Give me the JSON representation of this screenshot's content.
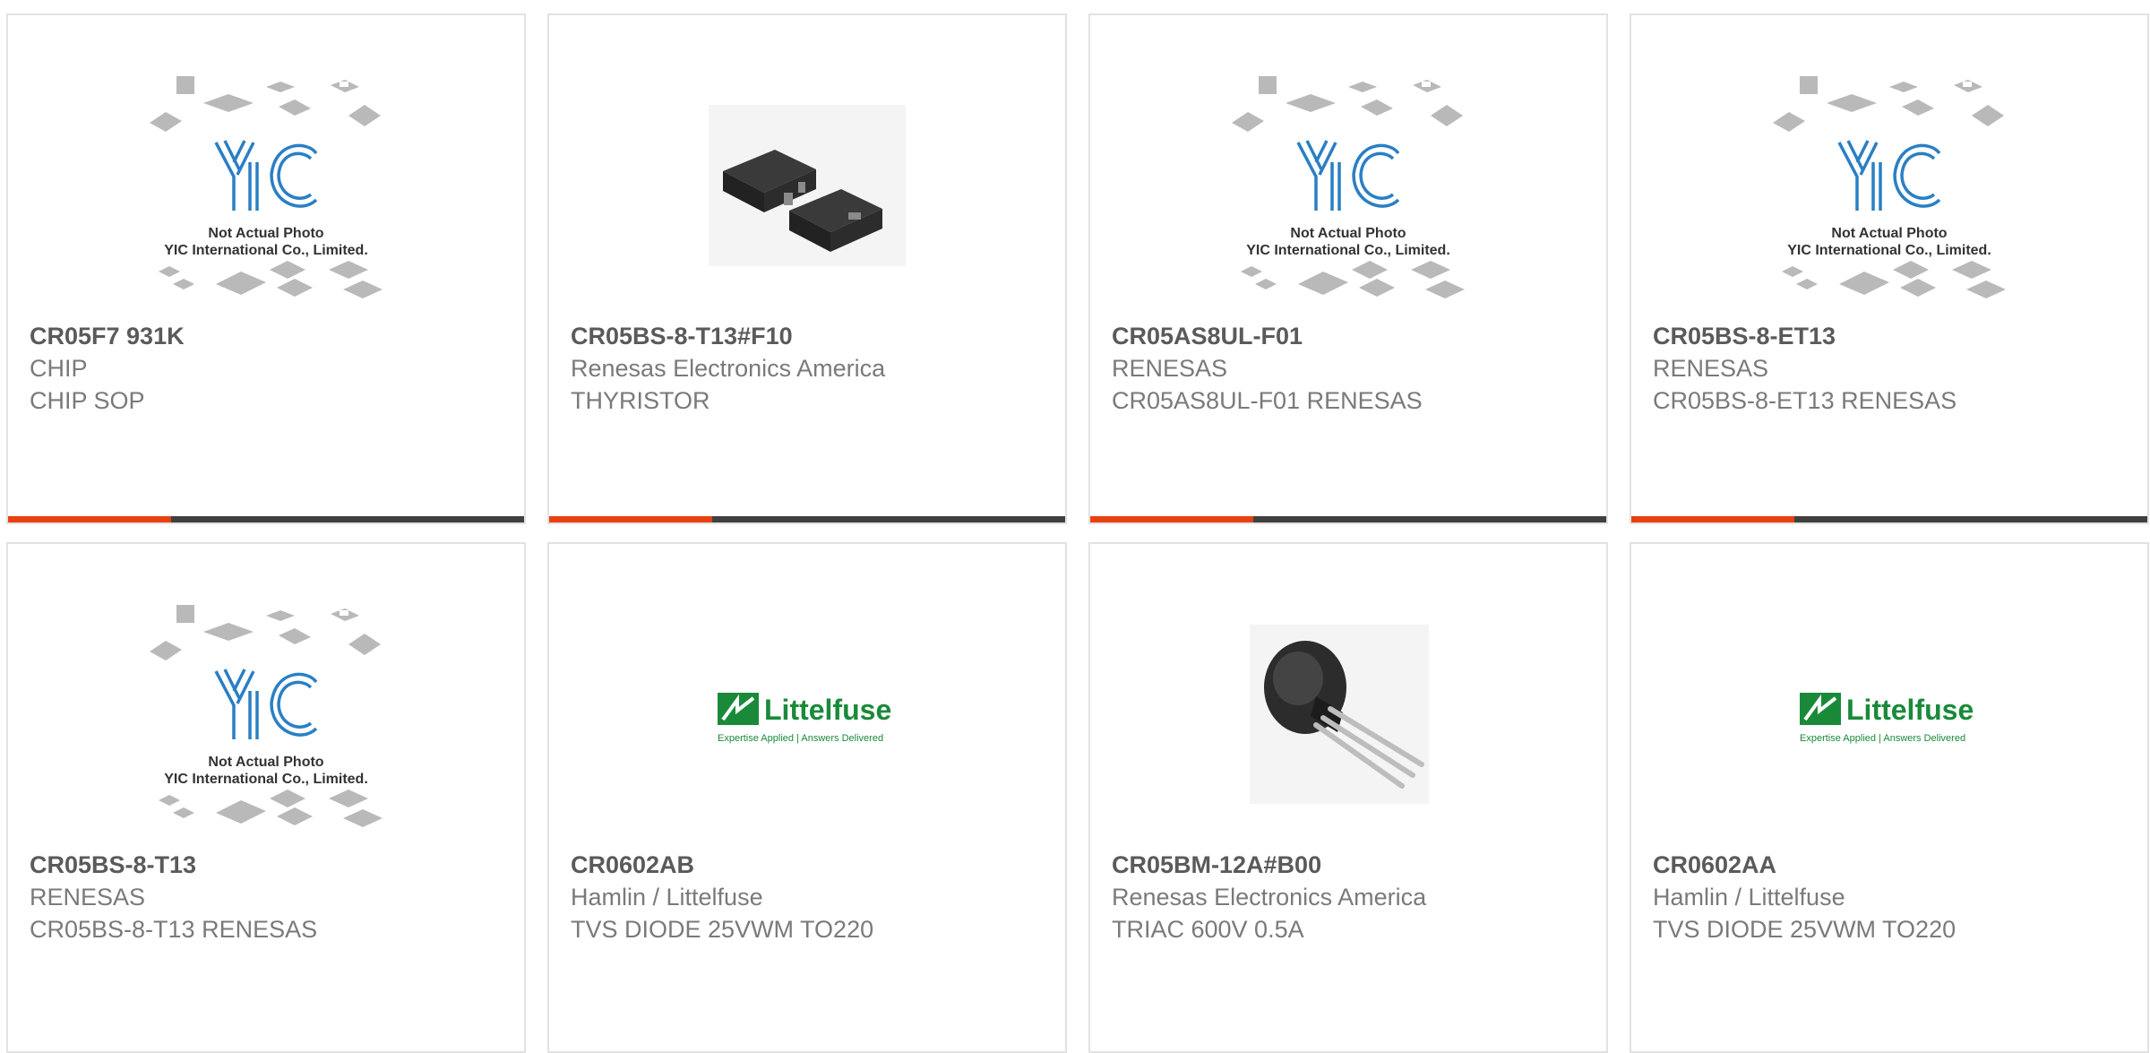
{
  "colors": {
    "accent": "#e8410f",
    "bar_dark": "#404040",
    "yic_blue": "#2a7fc4",
    "littelfuse_green": "#1a8a3a"
  },
  "placeholder": {
    "line1": "Not Actual Photo",
    "line2": "YIC International Co., Limited.",
    "logo_text": "YIC"
  },
  "littelfuse": {
    "name": "Littelfuse",
    "tagline": "Expertise Applied | Answers Delivered"
  },
  "products": [
    {
      "part": "CR05F7 931K",
      "manufacturer": "CHIP",
      "description": "CHIP SOP",
      "image": "yic-placeholder",
      "accent_bar": true
    },
    {
      "part": "CR05BS-8-T13#F10",
      "manufacturer": "Renesas Electronics America",
      "description": "THYRISTOR",
      "image": "sot23-package-photo",
      "accent_bar": true
    },
    {
      "part": "CR05AS8UL-F01",
      "manufacturer": "RENESAS",
      "description": "CR05AS8UL-F01 RENESAS",
      "image": "yic-placeholder",
      "accent_bar": true
    },
    {
      "part": "CR05BS-8-ET13",
      "manufacturer": "RENESAS",
      "description": "CR05BS-8-ET13 RENESAS",
      "image": "yic-placeholder",
      "accent_bar": true
    },
    {
      "part": "CR05BS-8-T13",
      "manufacturer": "RENESAS",
      "description": "CR05BS-8-T13 RENESAS",
      "image": "yic-placeholder",
      "accent_bar": false
    },
    {
      "part": "CR0602AB",
      "manufacturer": "Hamlin / Littelfuse",
      "description": "TVS DIODE 25VWM TO220",
      "image": "littelfuse-logo",
      "accent_bar": false
    },
    {
      "part": "CR05BM-12A#B00",
      "manufacturer": "Renesas Electronics America",
      "description": "TRIAC 600V 0.5A",
      "image": "to92-package-photo",
      "accent_bar": false
    },
    {
      "part": "CR0602AA",
      "manufacturer": "Hamlin / Littelfuse",
      "description": "TVS DIODE 25VWM TO220",
      "image": "littelfuse-logo",
      "accent_bar": false
    }
  ]
}
